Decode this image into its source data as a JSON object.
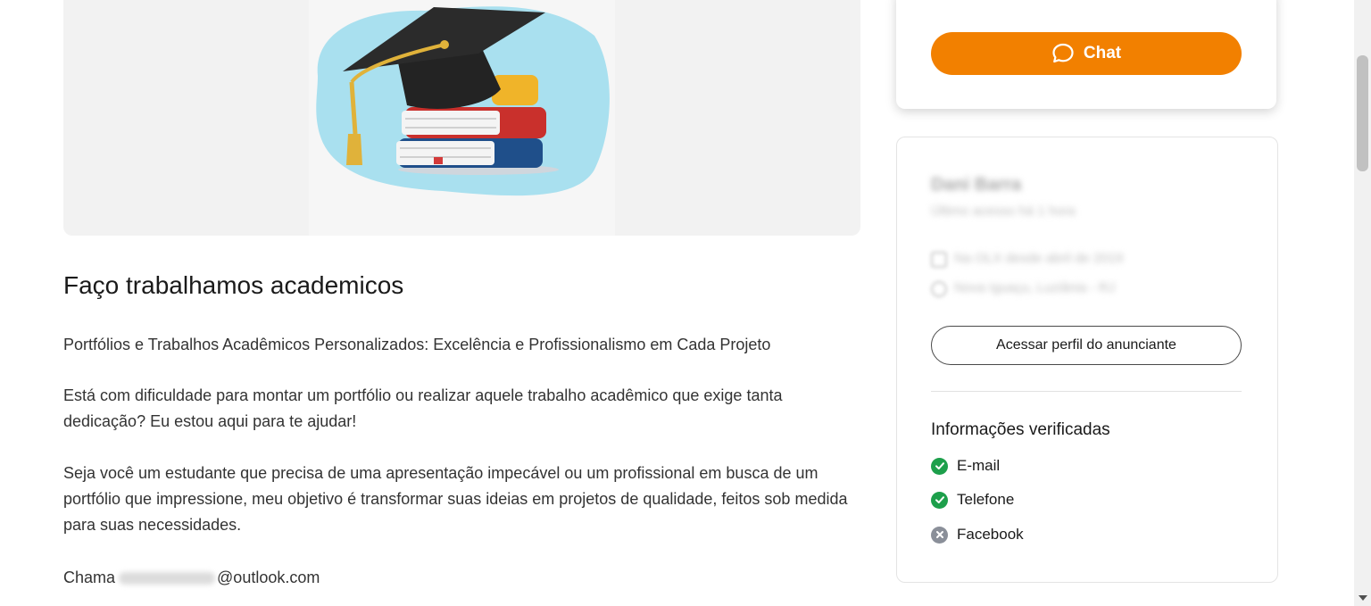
{
  "ad": {
    "title": "Faço trabalhamos academicos",
    "paragraph_1": "Portfólios e Trabalhos Acadêmicos Personalizados: Excelência e Profissionalismo em Cada Projeto",
    "paragraph_2": "Está com dificuldade para montar um portfólio ou realizar aquele trabalho acadêmico que exige tanta dedicação? Eu estou aqui para te ajudar!",
    "paragraph_3": "Seja você um estudante que precisa de uma apresentação impecável ou um profissional em busca de um portfólio que impressione, meu objetivo é transformar suas ideias em projetos de qualidade, feitos sob medida para suas necessidades.",
    "contact_prefix": "Chama",
    "contact_suffix": "@outlook.com",
    "image_icon": "graduation-cap-books-illustration"
  },
  "actions": {
    "chat_label": "Chat",
    "chat_icon": "chat-bubble-icon",
    "accent_color": "#f28000"
  },
  "seller": {
    "name": "Dani Barra",
    "subtitle": "Último acesso há 1 hora",
    "since": "Na OLX desde abril de 2019",
    "location": "Nova Iguaçu, Luziânia - RJ",
    "profile_button": "Acessar perfil do anunciante"
  },
  "verified": {
    "title": "Informações verificadas",
    "items": [
      {
        "label": "E-mail",
        "status": "verified",
        "color": "#1d9f4b"
      },
      {
        "label": "Telefone",
        "status": "verified",
        "color": "#1d9f4b"
      },
      {
        "label": "Facebook",
        "status": "not-verified",
        "color": "#8a8f99"
      }
    ]
  }
}
